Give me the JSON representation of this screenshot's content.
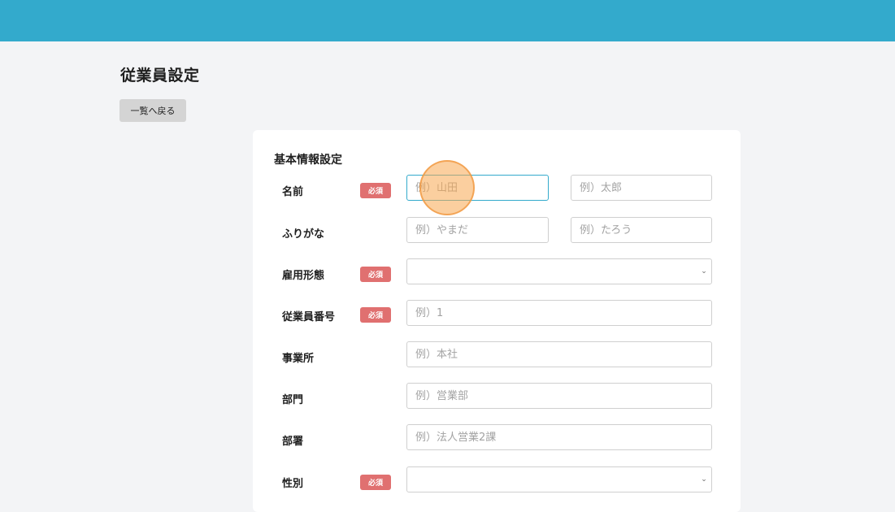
{
  "header": {
    "bar_color": "#33aacc"
  },
  "page": {
    "title": "従業員設定",
    "back_label": "一覧へ戻る"
  },
  "form": {
    "section_title": "基本情報設定",
    "required_label": "必須",
    "fields": {
      "name": {
        "label": "名前",
        "required": true,
        "last_placeholder": "例）山田",
        "first_placeholder": "例）太郎"
      },
      "furigana": {
        "label": "ふりがな",
        "required": false,
        "last_placeholder": "例）やまだ",
        "first_placeholder": "例）たろう"
      },
      "employment_type": {
        "label": "雇用形態",
        "required": true,
        "value": ""
      },
      "employee_number": {
        "label": "従業員番号",
        "required": true,
        "placeholder": "例）1"
      },
      "office": {
        "label": "事業所",
        "required": false,
        "placeholder": "例）本社"
      },
      "division": {
        "label": "部門",
        "required": false,
        "placeholder": "例）営業部"
      },
      "department": {
        "label": "部署",
        "required": false,
        "placeholder": "例）法人営業2課"
      },
      "gender": {
        "label": "性別",
        "required": true,
        "value": ""
      }
    }
  },
  "colors": {
    "accent": "#33aacc",
    "required_badge": "#e07070",
    "click_indicator": "#f8a850"
  },
  "icons": {
    "select_arrow": "chevron-down-icon"
  }
}
